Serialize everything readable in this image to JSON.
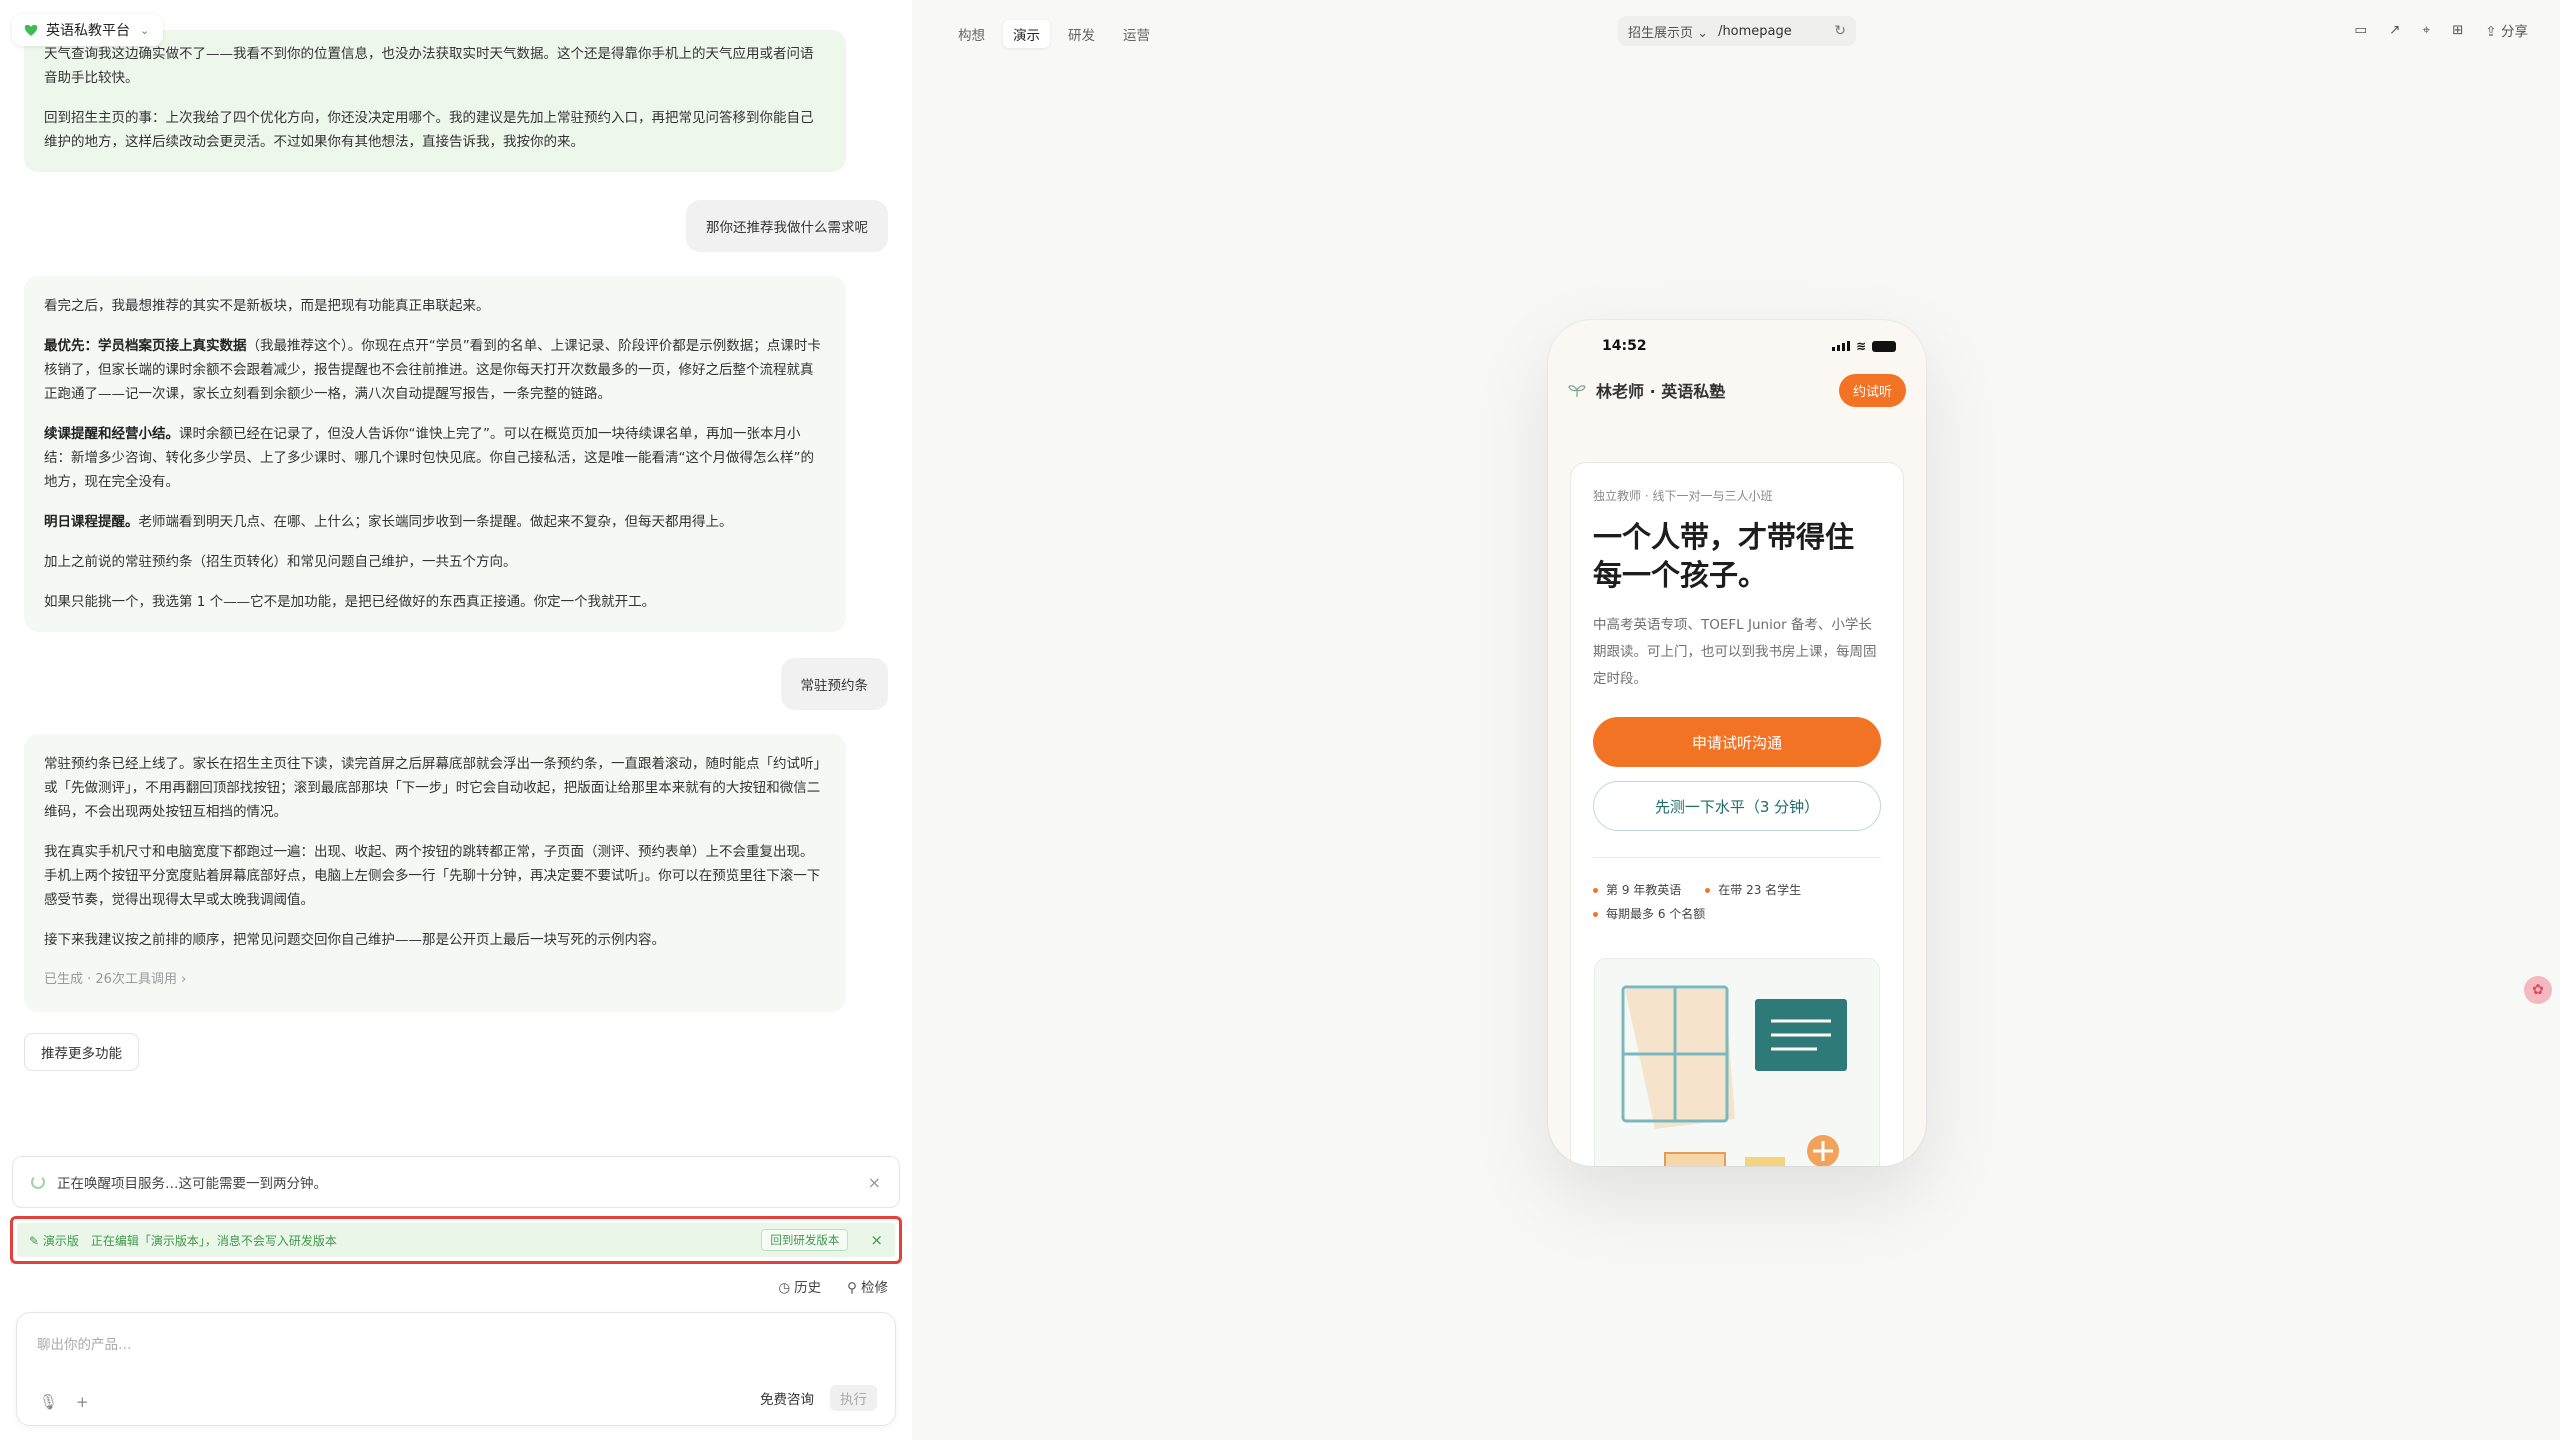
{
  "brand": {
    "name": "英语私教平台"
  },
  "chat": {
    "msg1": {
      "p1": "天气查询我这边确实做不了——我看不到你的位置信息，也没办法获取实时天气数据。这个还是得靠你手机上的天气应用或者问语音助手比较快。",
      "p2": "回到招生主页的事：上次我给了四个优化方向，你还没决定用哪个。我的建议是先加上常驻预约入口，再把常见问答移到你能自己维护的地方，这样后续改动会更灵活。不过如果你有其他想法，直接告诉我，我按你的来。"
    },
    "user1": "那你还推荐我做什么需求呢",
    "msg2": {
      "p1": "看完之后，我最想推荐的其实不是新板块，而是把现有功能真正串联起来。",
      "p2_b": "最优先：学员档案页接上真实数据",
      "p2": "（我最推荐这个）。你现在点开“学员”看到的名单、上课记录、阶段评价都是示例数据；点课时卡核销了，但家长端的课时余额不会跟着减少，报告提醒也不会往前推进。这是你每天打开次数最多的一页，修好之后整个流程就真正跑通了——记一次课，家长立刻看到余额少一格，满八次自动提醒写报告，一条完整的链路。",
      "p3_b": "续课提醒和经营小结。",
      "p3": "课时余额已经在记录了，但没人告诉你“谁快上完了”。可以在概览页加一块待续课名单，再加一张本月小结：新增多少咨询、转化多少学员、上了多少课时、哪几个课时包快见底。你自己接私活，这是唯一能看清“这个月做得怎么样”的地方，现在完全没有。",
      "p4_b": "明日课程提醒。",
      "p4": "老师端看到明天几点、在哪、上什么；家长端同步收到一条提醒。做起来不复杂，但每天都用得上。",
      "p5": "加上之前说的常驻预约条（招生页转化）和常见问题自己维护，一共五个方向。",
      "p6": "如果只能挑一个，我选第 1 个——它不是加功能，是把已经做好的东西真正接通。你定一个我就开工。"
    },
    "user2": "常驻预约条",
    "msg3": {
      "p1": "常驻预约条已经上线了。家长在招生主页往下读，读完首屏之后屏幕底部就会浮出一条预约条，一直跟着滚动，随时能点「约试听」或「先做测评」，不用再翻回顶部找按钮；滚到最底部那块「下一步」时它会自动收起，把版面让给那里本来就有的大按钮和微信二维码，不会出现两处按钮互相挡的情况。",
      "p2": "我在真实手机尺寸和电脑宽度下都跑过一遍：出现、收起、两个按钮的跳转都正常，子页面（测评、预约表单）上不会重复出现。手机上两个按钮平分宽度贴着屏幕底部好点，电脑上左侧会多一行「先聊十分钟，再决定要不要试听」。你可以在预览里往下滚一下感受节奏，觉得出现得太早或太晚我调阈值。",
      "p3": "接下来我建议按之前排的顺序，把常见问题交回你自己维护——那是公开页上最后一块写死的示例内容。",
      "meta": "已生成 · 26次工具调用"
    },
    "more_button": "推荐更多功能"
  },
  "status": {
    "waking": "正在唤醒项目服务…这可能需要一到两分钟。"
  },
  "demo_bar": {
    "tag": "演示版",
    "text": "正在编辑「演示版本」，消息不会写入研发版本",
    "back": "回到研发版本"
  },
  "footer_links": {
    "history": "历史",
    "repair": "检修"
  },
  "composer": {
    "placeholder": "聊出你的产品…",
    "free": "免费咨询",
    "run": "执行"
  },
  "right": {
    "tabs": [
      "构想",
      "演示",
      "研发",
      "运营"
    ],
    "active_tab": "演示",
    "url_page": "招生展示页",
    "url_path": "/homepage",
    "share": "分享"
  },
  "phone": {
    "time": "14:52",
    "site_title": "林老师 · 英语私塾",
    "header_cta": "约试听",
    "kicker": "独立教师 · 线下一对一与三人小班",
    "headline": "一个人带，才带得住每一个孩子。",
    "desc": "中高考英语专项、TOEFL Junior 备考、小学长期跟读。可上门，也可以到我书房上课，每周固定时段。",
    "primary_btn": "申请试听沟通",
    "secondary_btn": "先测一下水平（3 分钟）",
    "facts": [
      "第 9 年教英语",
      "在带 23 名学生",
      "每期最多 6 个名额"
    ]
  },
  "colors": {
    "accent_orange": "#f37325",
    "accent_green": "#3f9a4c",
    "alert_red": "#e2413c",
    "teal": "#1f6b6b"
  }
}
